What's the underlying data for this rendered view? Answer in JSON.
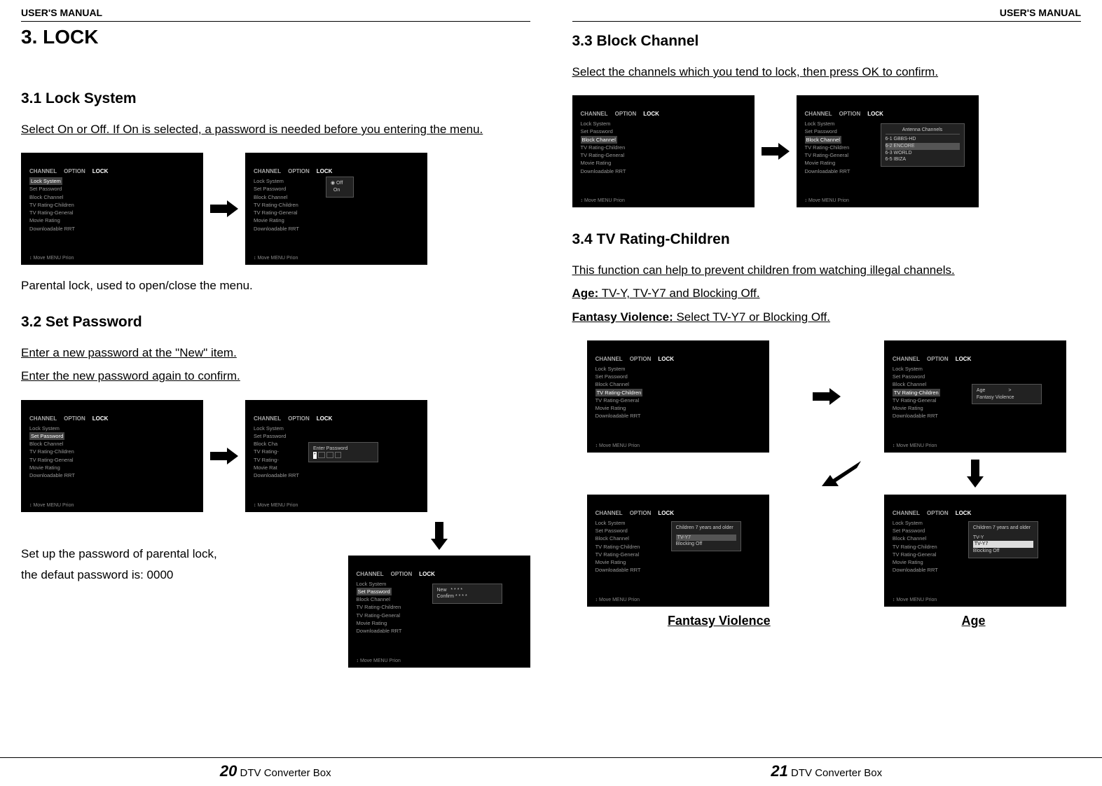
{
  "header": {
    "left": "USER'S MANUAL",
    "right": "USER'S MANUAL"
  },
  "chapter": {
    "title": "3. LOCK"
  },
  "left_page": {
    "s1": {
      "title": "3.1 Lock System",
      "desc": "Select On or Off. If On is selected, a password is needed before you entering the menu.",
      "caption": "Parental lock, used to open/close the menu."
    },
    "s2": {
      "title": "3.2 Set Password",
      "desc1": "Enter a new password at the \"New\" item.",
      "desc2": "Enter the new password again to confirm.",
      "caption1": "Set up the password of parental lock,",
      "caption2": "the defaut password is: 0000"
    }
  },
  "right_page": {
    "s3": {
      "title": "3.3 Block Channel",
      "desc": "Select the channels which you tend to lock, then press OK to confirm."
    },
    "s4": {
      "title": "3.4 TV Rating-Children",
      "desc": "This function can help to prevent children from watching illegal channels.",
      "age_label": "Age:",
      "age_text": " TV-Y, TV-Y7 and Blocking Off.",
      "fv_label": "Fantasy Violence:",
      "fv_text": " Select TV-Y7 or Blocking Off.",
      "caption_fv": "Fantasy Violence",
      "caption_age": "Age"
    }
  },
  "footer": {
    "left_num": "20",
    "right_num": "21",
    "product": " DTV Converter Box"
  },
  "menu": {
    "tabs": {
      "channel": "CHANNEL",
      "option": "OPTION",
      "lock": "LOCK"
    },
    "items": {
      "lock_system": "Lock System",
      "set_password": "Set Password",
      "block_channel": "Block Channel",
      "tv_rating_children": "TV Rating-Children",
      "tv_rating_general": "TV Rating-General",
      "movie_rating": "Movie Rating",
      "downloadable_rrt": "Downloadable RRT"
    },
    "footer_hint": "↕ Move   MENU Prion",
    "lock_opts": {
      "on": "Off",
      "enter": "Enter Password",
      "new": "New",
      "confirm": "Confirm"
    },
    "channels_title": "Antenna Channels",
    "channels": [
      "6-1  GBBS-HD",
      "6-2  ENCORE",
      "6-3  WORLD",
      "6-5  IBIZA"
    ],
    "age_panel": {
      "hint": "Children 7 years and older",
      "tvy": "TV-Y",
      "tvy7": "TV-Y7",
      "blocking": "Blocking Off"
    },
    "fv_sub": {
      "age": "Age",
      "fv": "Fantasy Violence"
    }
  }
}
